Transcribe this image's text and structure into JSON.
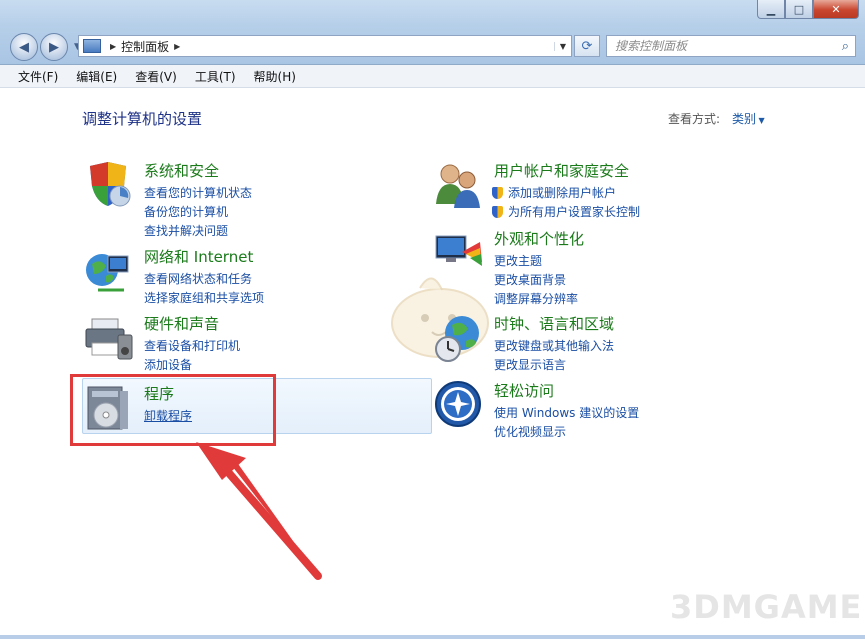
{
  "window": {
    "minimize": "▁",
    "maximize": "□",
    "close": "✕"
  },
  "address": {
    "path": "控制面板",
    "search_placeholder": "搜索控制面板"
  },
  "menu": [
    "文件(F)",
    "编辑(E)",
    "查看(V)",
    "工具(T)",
    "帮助(H)"
  ],
  "page": {
    "title": "调整计算机的设置",
    "view_by_label": "查看方式:",
    "view_by_value": "类别"
  },
  "categories": {
    "system": {
      "title": "系统和安全",
      "links": [
        "查看您的计算机状态",
        "备份您的计算机",
        "查找并解决问题"
      ]
    },
    "network": {
      "title": "网络和 Internet",
      "links": [
        "查看网络状态和任务",
        "选择家庭组和共享选项"
      ]
    },
    "hardware": {
      "title": "硬件和声音",
      "links": [
        "查看设备和打印机",
        "添加设备"
      ]
    },
    "programs": {
      "title": "程序",
      "links": [
        "卸载程序"
      ]
    },
    "users": {
      "title": "用户帐户和家庭安全",
      "links": [
        "添加或删除用户帐户",
        "为所有用户设置家长控制"
      ]
    },
    "appearance": {
      "title": "外观和个性化",
      "links": [
        "更改主题",
        "更改桌面背景",
        "调整屏幕分辨率"
      ]
    },
    "clock": {
      "title": "时钟、语言和区域",
      "links": [
        "更改键盘或其他输入法",
        "更改显示语言"
      ]
    },
    "ease": {
      "title": "轻松访问",
      "links": [
        "使用 Windows 建议的设置",
        "优化视频显示"
      ]
    }
  },
  "watermark": "3DMGAME",
  "colors": {
    "title_green": "#1a7a1a",
    "link_blue": "#1a4ea4",
    "highlight_red": "#e03a3a"
  }
}
